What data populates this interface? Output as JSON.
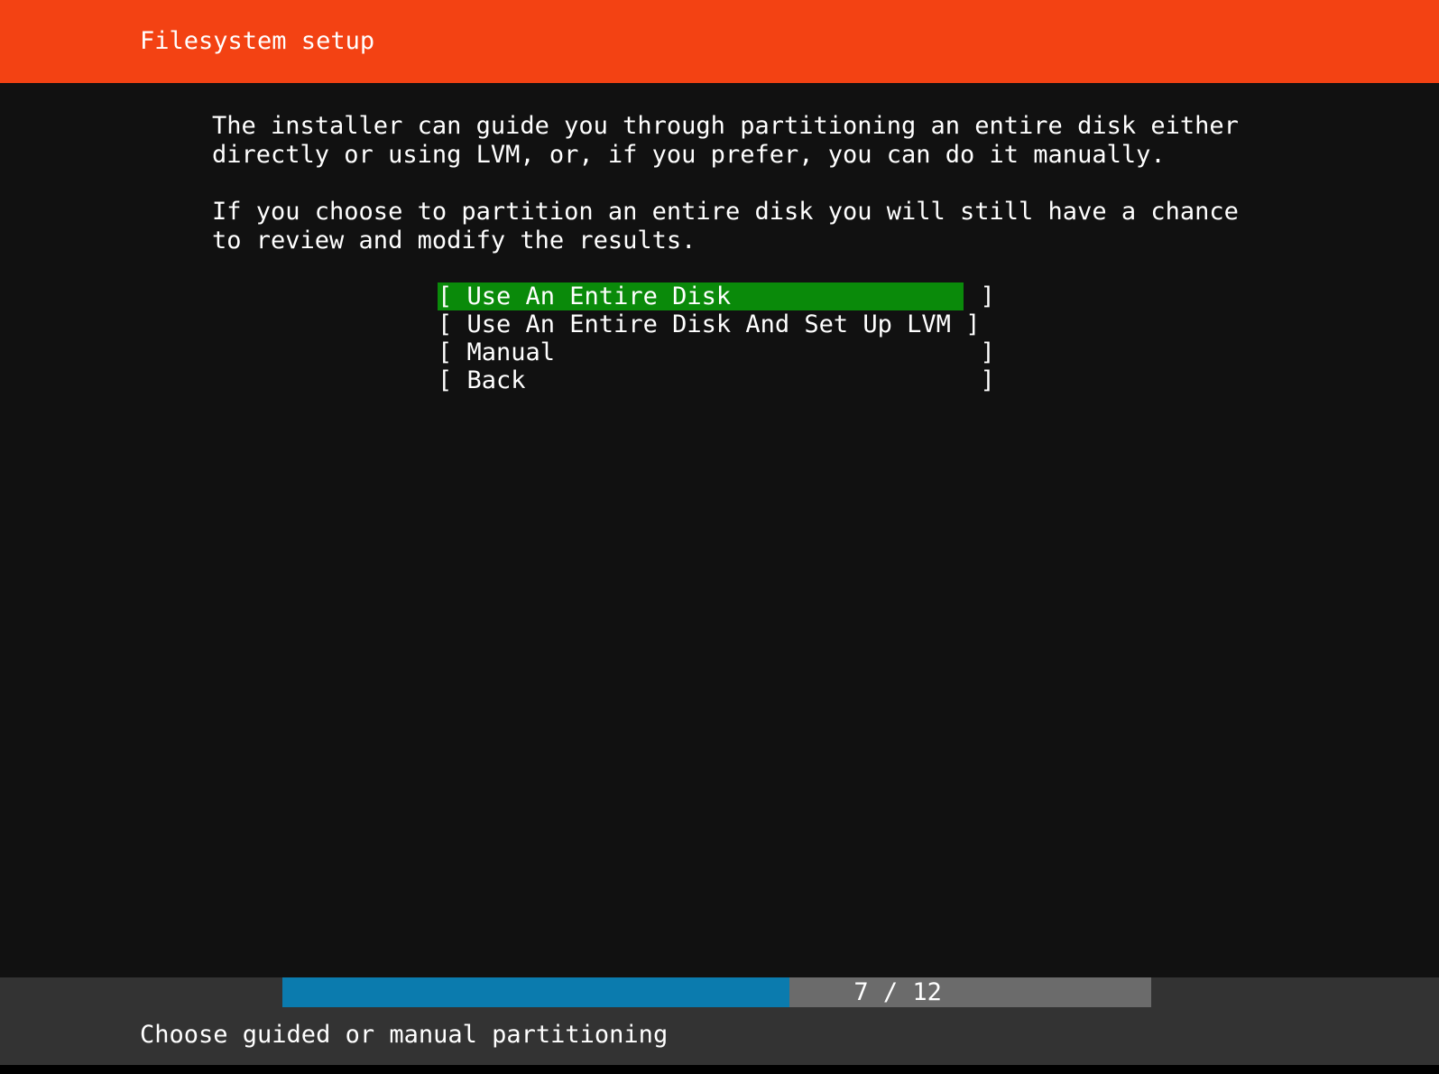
{
  "header": {
    "title": "Filesystem setup",
    "bg_color": "#f34213",
    "fg_color": "#ffffff"
  },
  "screen": {
    "bg_color": "#111111",
    "fg_color": "#ffffff"
  },
  "main": {
    "paragraphs": [
      "The installer can guide you through partitioning an entire disk either\ndirectly or using LVM, or, if you prefer, you can do it manually.",
      "If you choose to partition an entire disk you will still have a chance\nto review and modify the results."
    ],
    "menu": {
      "selected_index": 0,
      "selected_bg_color": "#0a8a0a",
      "open_bracket": "[",
      "close_bracket": "]",
      "field_width": 35,
      "items": [
        {
          "label": "Use An Entire Disk",
          "row": "[ Use An Entire Disk                 ]"
        },
        {
          "label": "Use An Entire Disk And Set Up LVM",
          "row": "[ Use An Entire Disk And Set Up LVM ]"
        },
        {
          "label": "Manual",
          "row": "[ Manual                             ]"
        },
        {
          "label": "Back",
          "row": "[ Back                               ]"
        }
      ]
    }
  },
  "footer": {
    "progress": {
      "current": 7,
      "total": 12,
      "label": "7 / 12",
      "percent": 57,
      "fill_color": "#0b7bae",
      "track_color": "#6b6b6b"
    },
    "status_text": "Choose guided or manual partitioning",
    "bg_color": "#333333"
  }
}
